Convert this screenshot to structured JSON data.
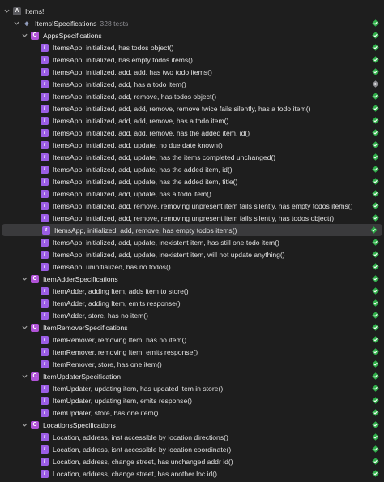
{
  "colors": {
    "background": "#1e1e1e",
    "passed": "#30b04a",
    "class_badge": "#b153d8",
    "method_badge": "#9b5de5",
    "selected_row": "#3a3a3c"
  },
  "tree": [
    {
      "kind": "project",
      "label": "Items!",
      "count": "",
      "status": "none",
      "level": 0,
      "chevron": "down",
      "badge": "A"
    },
    {
      "kind": "scheme",
      "label": "Items!Specifications",
      "count": "328 tests",
      "status": "passed",
      "level": 1,
      "chevron": "down",
      "badge": "◈"
    },
    {
      "kind": "class",
      "label": "AppsSpecifications",
      "count": "",
      "status": "passed",
      "level": 2,
      "chevron": "down",
      "badge": "C"
    },
    {
      "kind": "method",
      "label": "ItemsApp, initialized, has todos object()",
      "status": "passed",
      "level": 3
    },
    {
      "kind": "method",
      "label": "ItemsApp, initialized, has empty todos items()",
      "status": "passed",
      "level": 3
    },
    {
      "kind": "method",
      "label": "ItemsApp, initialized, add, add, has two todo items()",
      "status": "passed",
      "level": 3
    },
    {
      "kind": "method",
      "label": "ItemsApp, initialized, add, has a todo item()",
      "status": "run",
      "level": 3
    },
    {
      "kind": "method",
      "label": "ItemsApp, initialized, add, remove, has todos object()",
      "status": "passed",
      "level": 3
    },
    {
      "kind": "method",
      "label": "ItemsApp, initialized, add, add, remove, remove twice fails silently, has a todo item()",
      "status": "passed",
      "level": 3
    },
    {
      "kind": "method",
      "label": "ItemsApp, initialized, add, add, remove, has a todo item()",
      "status": "passed",
      "level": 3
    },
    {
      "kind": "method",
      "label": "ItemsApp, initialized, add, add, remove, has the added item, id()",
      "status": "passed",
      "level": 3
    },
    {
      "kind": "method",
      "label": "ItemsApp, initialized, add, update, no due date known()",
      "status": "passed",
      "level": 3
    },
    {
      "kind": "method",
      "label": "ItemsApp, initialized, add, update, has the items completed unchanged()",
      "status": "passed",
      "level": 3
    },
    {
      "kind": "method",
      "label": "ItemsApp, initialized, add, update, has the added item, id()",
      "status": "passed",
      "level": 3
    },
    {
      "kind": "method",
      "label": "ItemsApp, initialized, add, update, has the added item, title()",
      "status": "passed",
      "level": 3
    },
    {
      "kind": "method",
      "label": "ItemsApp, initialized, add, update, has a todo item()",
      "status": "passed",
      "level": 3
    },
    {
      "kind": "method",
      "label": "ItemsApp, initialized, add, remove, removing unpresent item fails silently, has empty todos items()",
      "status": "passed",
      "level": 3
    },
    {
      "kind": "method",
      "label": "ItemsApp, initialized, add, remove, removing unpresent item fails silently, has todos object()",
      "status": "passed",
      "level": 3
    },
    {
      "kind": "method",
      "label": "ItemsApp, initialized, add, remove, has empty todos items()",
      "status": "passed",
      "level": 3,
      "selected": true
    },
    {
      "kind": "method",
      "label": "ItemsApp, initialized, add, update, inexistent item, has still one todo item()",
      "status": "passed",
      "level": 3
    },
    {
      "kind": "method",
      "label": "ItemsApp, initialized, add, update, inexistent item, will not update anything()",
      "status": "passed",
      "level": 3
    },
    {
      "kind": "method",
      "label": "ItemsApp, uninitialized, has no todos()",
      "status": "passed",
      "level": 3
    },
    {
      "kind": "class",
      "label": "ItemAdderSpecifications",
      "count": "",
      "status": "passed",
      "level": 2,
      "chevron": "down",
      "badge": "C"
    },
    {
      "kind": "method",
      "label": "ItemAdder, adding Item, adds item to store()",
      "status": "passed",
      "level": 3
    },
    {
      "kind": "method",
      "label": "ItemAdder, adding Item, emits response()",
      "status": "passed",
      "level": 3
    },
    {
      "kind": "method",
      "label": "ItemAdder, store, has no item()",
      "status": "passed",
      "level": 3
    },
    {
      "kind": "class",
      "label": "ItemRemoverSpecifications",
      "count": "",
      "status": "passed",
      "level": 2,
      "chevron": "down",
      "badge": "C"
    },
    {
      "kind": "method",
      "label": "ItemRemover, removing Item, has no item()",
      "status": "passed",
      "level": 3
    },
    {
      "kind": "method",
      "label": "ItemRemover, removing Item, emits response()",
      "status": "passed",
      "level": 3
    },
    {
      "kind": "method",
      "label": "ItemRemover, store, has one item()",
      "status": "passed",
      "level": 3
    },
    {
      "kind": "class",
      "label": "ItemUpdaterSpecification",
      "count": "",
      "status": "passed",
      "level": 2,
      "chevron": "down",
      "badge": "C"
    },
    {
      "kind": "method",
      "label": "ItemUpdater, updating item, has updated item in store()",
      "status": "passed",
      "level": 3
    },
    {
      "kind": "method",
      "label": "ItemUpdater, updating item, emits response()",
      "status": "passed",
      "level": 3
    },
    {
      "kind": "method",
      "label": "ItemUpdater, store, has one item()",
      "status": "passed",
      "level": 3
    },
    {
      "kind": "class",
      "label": "LocationsSpecifications",
      "count": "",
      "status": "passed",
      "level": 2,
      "chevron": "down",
      "badge": "C"
    },
    {
      "kind": "method",
      "label": "Location, address, inst accessible by location directions()",
      "status": "passed",
      "level": 3
    },
    {
      "kind": "method",
      "label": "Location, address, isnt accessible by location coordinate()",
      "status": "passed",
      "level": 3
    },
    {
      "kind": "method",
      "label": "Location, address, change street, has unchanged addr id()",
      "status": "passed",
      "level": 3
    },
    {
      "kind": "method",
      "label": "Location, address, change street, has another loc id()",
      "status": "passed",
      "level": 3
    }
  ]
}
